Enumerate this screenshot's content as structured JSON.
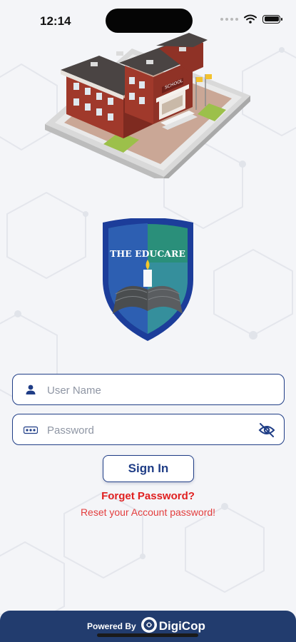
{
  "status_bar": {
    "time": "12:14"
  },
  "logo": {
    "text": "THE EDUCARE"
  },
  "illustration": {
    "sign": "SCHOOL"
  },
  "login": {
    "username_placeholder": "User Name",
    "password_placeholder": "Password",
    "signin_label": "Sign In",
    "forget_label": "Forget Password?",
    "reset_label": "Reset your Account password!"
  },
  "footer": {
    "powered_label": "Powered By",
    "brand": "DigiCop"
  },
  "colors": {
    "primary": "#1f3d86",
    "link_red": "#e02020",
    "footer_bg": "#223c6e",
    "background": "#f4f5f8"
  },
  "icons": [
    "wifi-icon",
    "battery-icon",
    "user-icon",
    "password-dots-icon",
    "eye-off-icon",
    "digicop-icon"
  ]
}
